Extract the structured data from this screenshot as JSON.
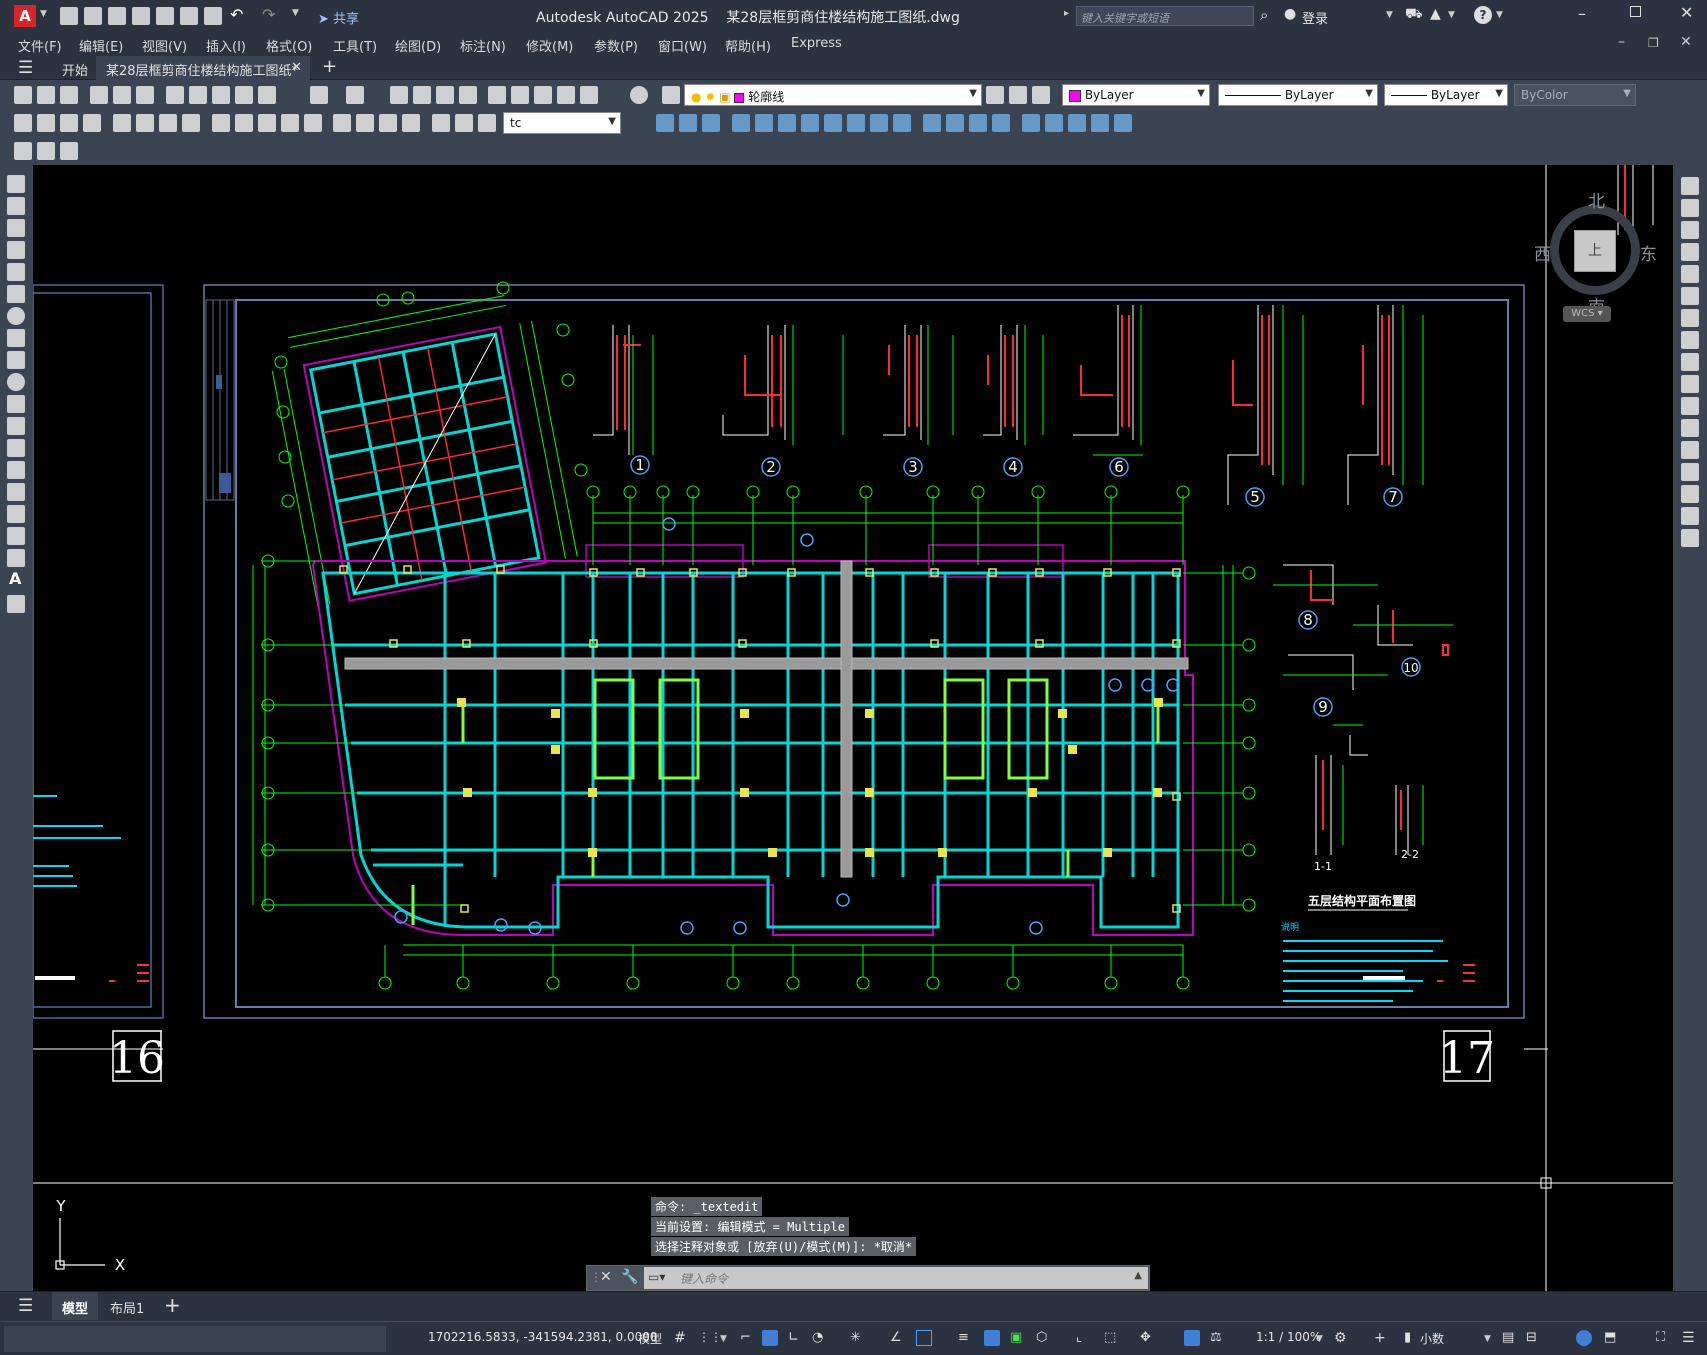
{
  "app": {
    "title": "Autodesk AutoCAD 2025",
    "document": "某28层框剪商住楼结构施工图纸.dwg",
    "share_label": "共享",
    "search_placeholder": "键入关键字或短语",
    "login_label": "登录"
  },
  "menu": [
    "文件(F)",
    "编辑(E)",
    "视图(V)",
    "插入(I)",
    "格式(O)",
    "工具(T)",
    "绘图(D)",
    "标注(N)",
    "修改(M)",
    "参数(P)",
    "窗口(W)",
    "帮助(H)",
    "Express"
  ],
  "tabs": {
    "start": "开始",
    "active": "某28层框剪商住楼结构施工图纸*"
  },
  "toolbar": {
    "layer_name": "轮廓线",
    "color": "ByLayer",
    "linetype": "ByLayer",
    "lineweight": "ByLayer",
    "plotstyle": "ByColor",
    "textstyle": "tc"
  },
  "viewcube": {
    "north": "北",
    "south": "南",
    "east": "东",
    "west": "西",
    "top": "上",
    "wcs": "WCS"
  },
  "drawing": {
    "sheet_left_number": "16",
    "sheet_right_number": "17",
    "plan_title": "五层结构平面布置图",
    "section_1": "1-1",
    "section_2": "2-2",
    "detail_labels": [
      "1",
      "2",
      "3",
      "4",
      "5",
      "6",
      "7",
      "8",
      "9",
      "10"
    ],
    "note_title": "说明"
  },
  "ucs": {
    "x": "X",
    "y": "Y"
  },
  "command": {
    "history": [
      "命令: _textedit",
      "当前设置: 编辑模式 = Multiple",
      "选择注释对象或 [放弃(U)/模式(M)]: *取消*"
    ],
    "placeholder": "键入命令"
  },
  "layout_tabs": [
    "模型",
    "布局1"
  ],
  "status": {
    "coords": "1702216.5833, -341594.2381, 0.0000",
    "model": "模型",
    "scale": "1:1 / 100%",
    "units": "小数"
  },
  "colors": {
    "titlebar": "#2b3240",
    "canvas": "#000000",
    "accent_red": "#d9252a",
    "beam": "#00d8d8",
    "grid": "#00ff00",
    "wall": "#ff2a2a"
  }
}
